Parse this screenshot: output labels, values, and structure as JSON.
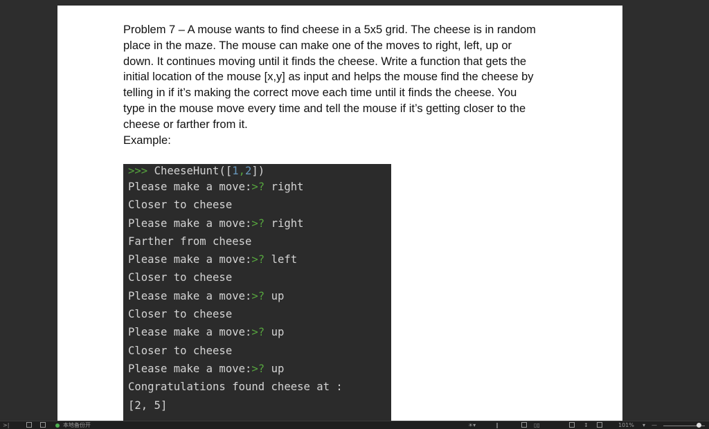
{
  "problem": {
    "lines": [
      "Problem 7 – A mouse wants to find cheese in a 5x5 grid. The cheese is in random",
      "place in the maze. The mouse can make one of the moves to right, left, up or",
      "down. It continues moving until it finds the cheese. Write a function that gets the",
      "initial location of the mouse [x,y] as input and helps the mouse find the cheese by",
      "telling in if it’s making the correct move each time until it finds the cheese. You",
      "type in the mouse move every time and tell the mouse if it’s getting closer to the",
      "cheese or farther from it.",
      "Example:"
    ]
  },
  "console": {
    "prompt": ">>>",
    "command_name": "CheeseHunt(",
    "command_open": "[",
    "arg1": "1",
    "sep": ",",
    "arg2": "2",
    "command_close": "])",
    "input_prompt": ">?",
    "move_label": "Please make a move:",
    "moves": [
      "right",
      "right",
      "left",
      "up",
      "up",
      "up"
    ],
    "responses": [
      "Closer to cheese",
      "Farther from cheese",
      "Closer to cheese",
      "Closer to cheese",
      "Closer to cheese"
    ],
    "final_line": "Congratulations found cheese at :",
    "final_value": "[2, 5]"
  },
  "statusbar": {
    "left_text": "本地备份开",
    "zoom": "101%"
  },
  "colors": {
    "console_bg": "#2b2b2b",
    "prompt_green": "#56a53e",
    "number_blue": "#6897bb"
  }
}
